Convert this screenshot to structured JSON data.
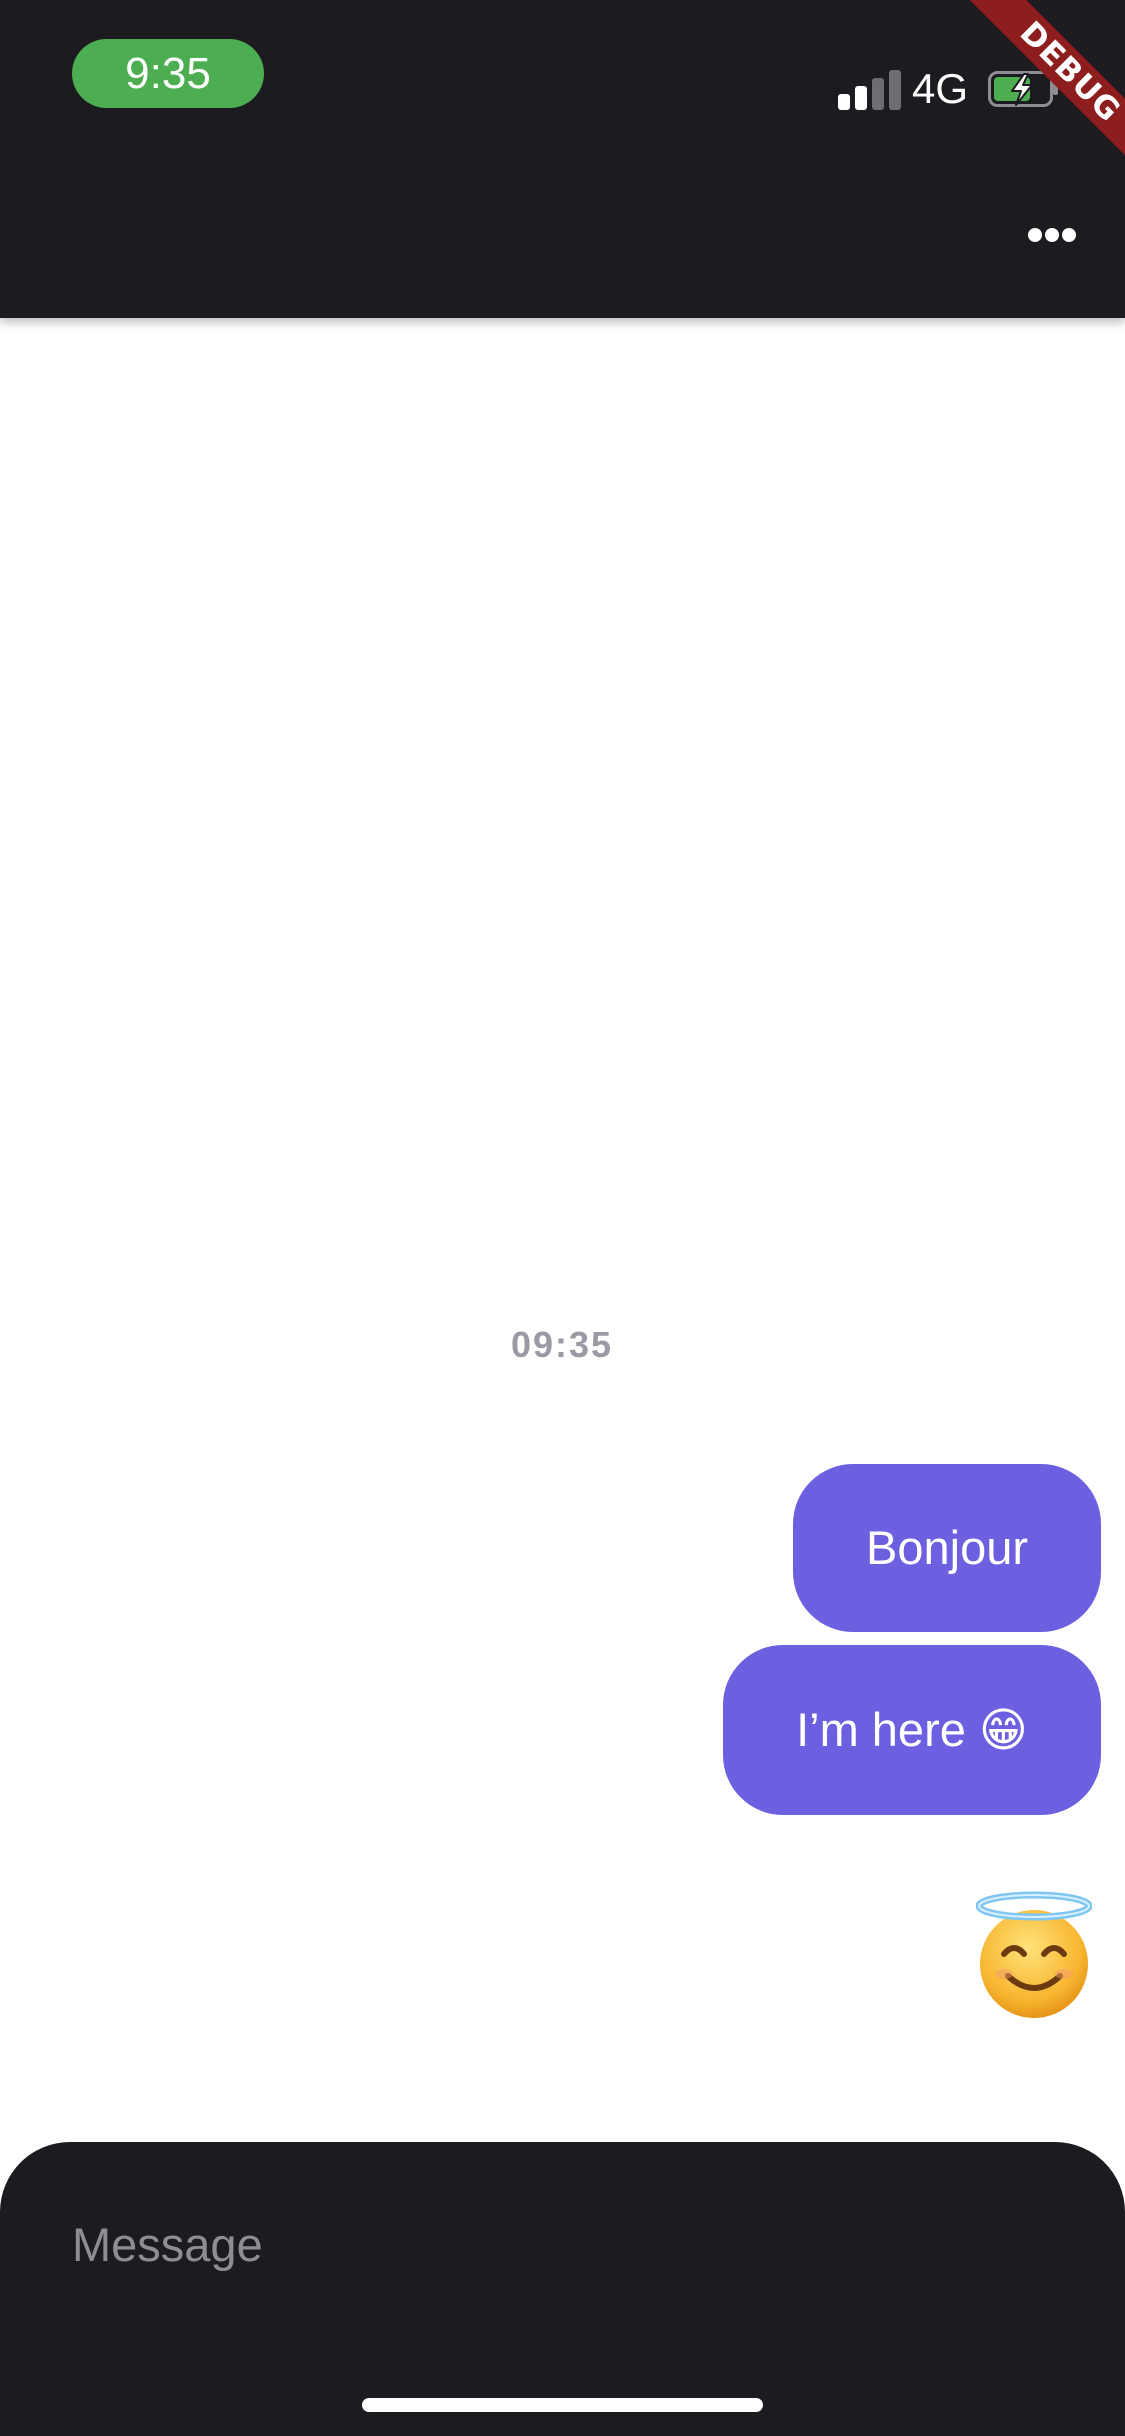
{
  "status_bar": {
    "time": "9:35",
    "network": "4G",
    "debug_banner": "DEBUG"
  },
  "app_bar": {
    "menu_icon": "more-horizontal-icon"
  },
  "chat": {
    "timestamp": "09:35",
    "messages": [
      {
        "text": "Bonjour",
        "from": "me"
      },
      {
        "text": "I’m here 😁",
        "from": "me"
      },
      {
        "emoji": "😇",
        "from": "me",
        "icon": "smiling-face-with-halo-icon"
      }
    ]
  },
  "composer": {
    "placeholder": "Message"
  },
  "colors": {
    "header_bg": "#1c1b20",
    "bubble_bg": "#6c5fe0",
    "time_pill": "#4cae50",
    "timestamp_text": "#9a9aa4",
    "placeholder_text": "#8d8d93",
    "debug_banner": "#8e1e1e"
  }
}
